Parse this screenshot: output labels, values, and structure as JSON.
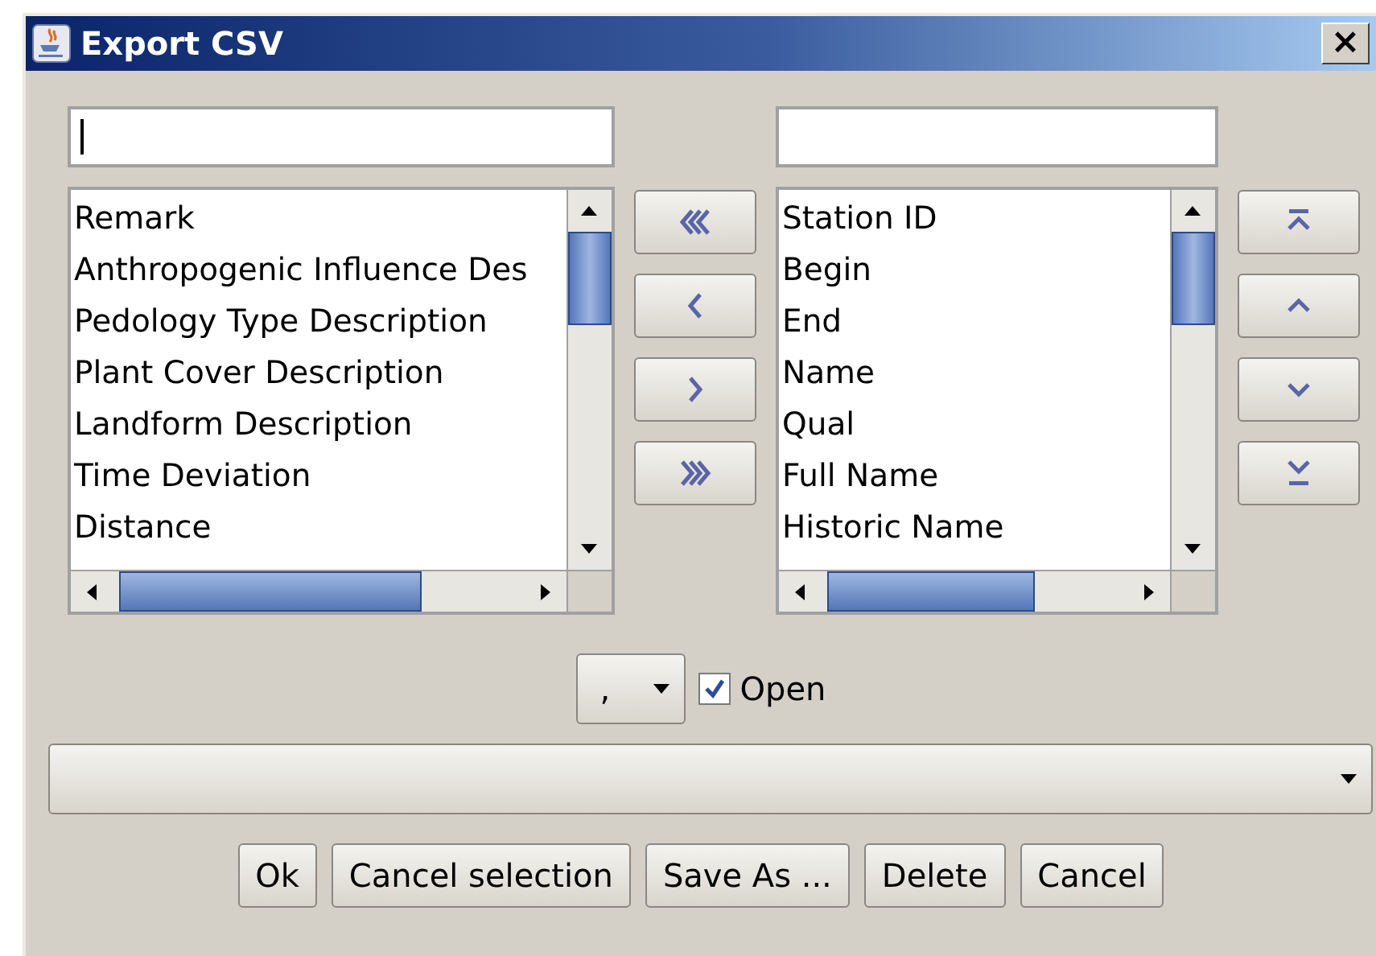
{
  "window": {
    "title": "Export CSV",
    "close": "×"
  },
  "available": {
    "items": [
      {
        "label": "Remark",
        "selected": false
      },
      {
        "label": "Anthropogenic Influence Des",
        "selected": false
      },
      {
        "label": "Pedology Type Description",
        "selected": false
      },
      {
        "label": "Plant Cover Description",
        "selected": false
      },
      {
        "label": "Landform Description",
        "selected": false
      },
      {
        "label": "Time Deviation",
        "selected": false
      },
      {
        "label": "Distance",
        "selected": false
      }
    ]
  },
  "move_buttons": [
    {
      "kind": "all-left"
    },
    {
      "kind": "left"
    },
    {
      "kind": "right"
    },
    {
      "kind": "all-right"
    }
  ],
  "chosen": {
    "items": [
      {
        "label": "Station ID",
        "selected": false
      },
      {
        "label": "Begin",
        "selected": false
      },
      {
        "label": "End",
        "selected": false
      },
      {
        "label": "Name",
        "selected": false
      },
      {
        "label": "Qual",
        "selected": false
      },
      {
        "label": "Full Name",
        "selected": false
      },
      {
        "label": "Historic Name",
        "selected": false
      }
    ]
  },
  "order_buttons": [
    {
      "kind": "top"
    },
    {
      "kind": "up"
    },
    {
      "kind": "down"
    },
    {
      "kind": "bottom"
    }
  ],
  "separator": {
    "value": ","
  },
  "open": {
    "label": "Open",
    "checked": true
  },
  "buttons": [
    "Ok",
    "Cancel selection",
    "Save As ...",
    "Delete",
    "Cancel"
  ]
}
